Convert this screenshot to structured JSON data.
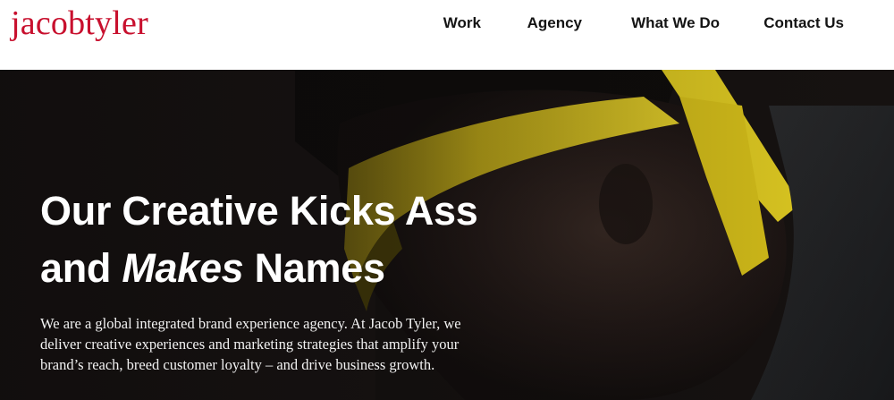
{
  "brand": {
    "logo_text": "jacobtyler",
    "logo_color": "#c8102e"
  },
  "nav": {
    "items": [
      {
        "label": "Work"
      },
      {
        "label": "Agency"
      },
      {
        "label": "What We Do"
      },
      {
        "label": "Contact Us"
      }
    ]
  },
  "hero": {
    "headline_line1": "Our Creative Kicks Ass",
    "headline_and": "and ",
    "headline_emphasis": "Makes",
    "headline_end": " Names",
    "body": "We are a global integrated brand experience agency. At Jacob Tyler, we deliver creative experiences and marketing strategies that amplify your brand’s reach, breed customer loyalty – and drive business growth.",
    "accent_color": "#d9c21a",
    "background_color": "#141110"
  }
}
